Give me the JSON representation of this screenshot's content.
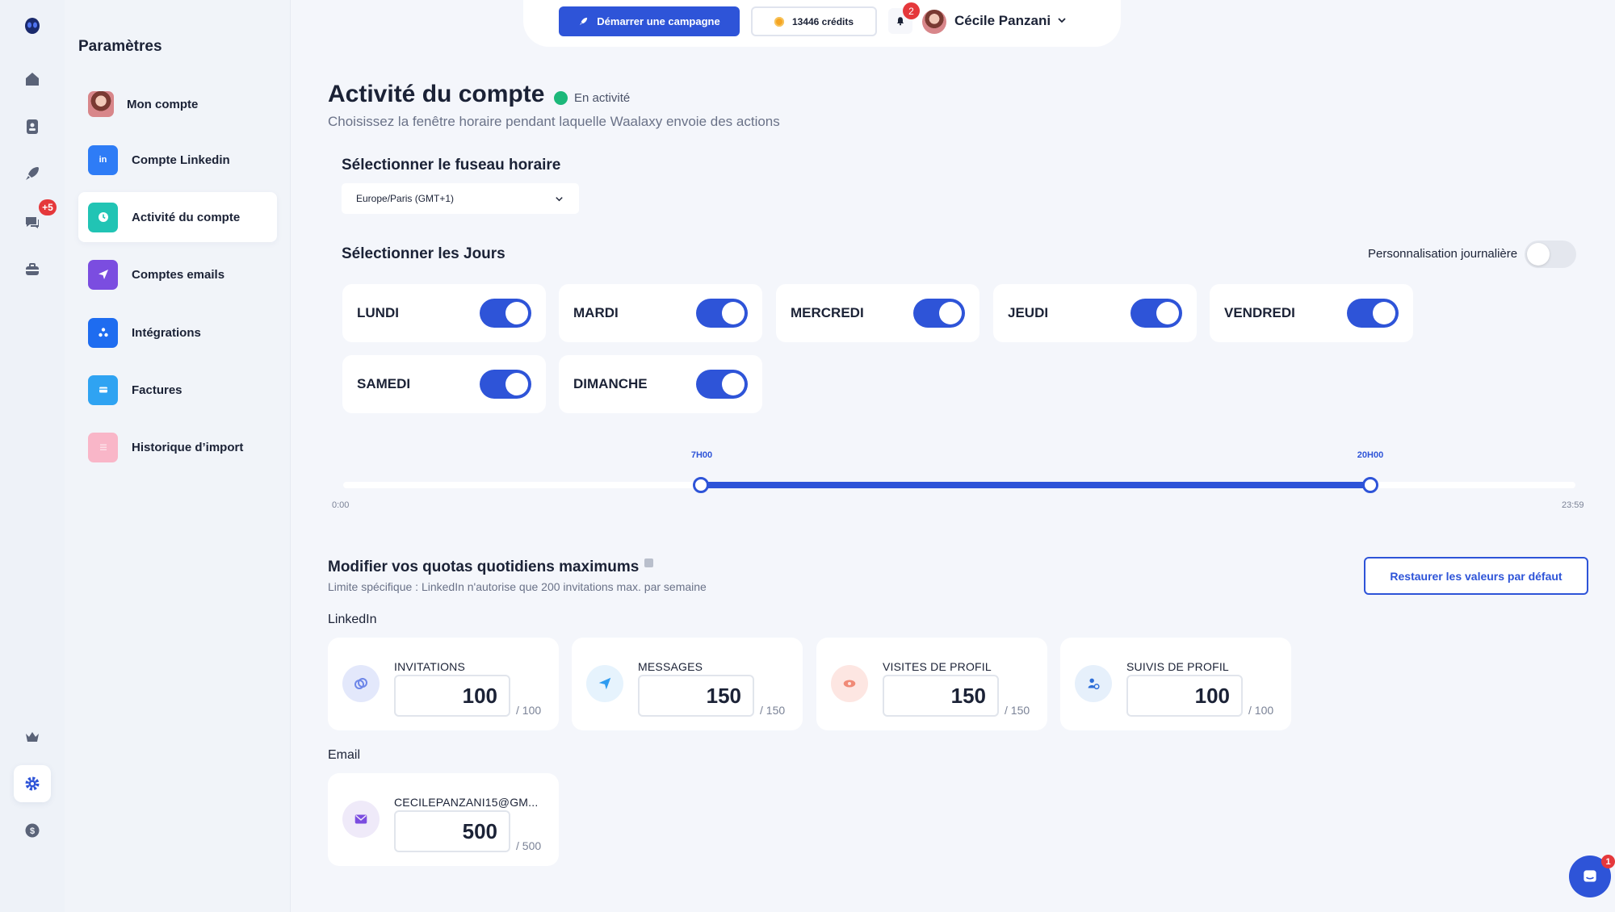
{
  "topbar": {
    "campaign_label": "Démarrer une campagne",
    "credits_label": "13446 crédits",
    "notif_count": "2",
    "user_name": "Cécile Panzani"
  },
  "rail": {
    "messages_badge": "+5"
  },
  "sidebar": {
    "title": "Paramètres",
    "items": [
      {
        "label": "Mon compte",
        "icon": "avatar"
      },
      {
        "label": "Compte Linkedin",
        "icon": "linkedin-icon",
        "glyph": "in",
        "color": "#2e7cf6"
      },
      {
        "label": "Activité du compte",
        "icon": "clock-icon",
        "color": "#21c4b4"
      },
      {
        "label": "Comptes emails",
        "icon": "paper-plane-icon",
        "color": "#7b4de0"
      },
      {
        "label": "Intégrations",
        "icon": "integrations-icon",
        "color": "#1e6cf0"
      },
      {
        "label": "Factures",
        "icon": "invoice-icon",
        "color": "#2fa3f2"
      },
      {
        "label": "Historique d’import",
        "icon": "list-icon",
        "color": "#f9b6c8"
      }
    ]
  },
  "page": {
    "title": "Activité du compte",
    "status": "En activité",
    "subtitle": "Choisissez la fenêtre horaire pendant laquelle Waalaxy envoie des actions"
  },
  "timezone": {
    "heading": "Sélectionner le fuseau horaire",
    "value": "Europe/Paris (GMT+1)"
  },
  "days": {
    "heading": "Sélectionner les Jours",
    "personalize_label": "Personnalisation journalière",
    "personalize_on": false,
    "items": [
      {
        "label": "LUNDI",
        "on": true
      },
      {
        "label": "MARDI",
        "on": true
      },
      {
        "label": "MERCREDI",
        "on": true
      },
      {
        "label": "JEUDI",
        "on": true
      },
      {
        "label": "VENDREDI",
        "on": true
      },
      {
        "label": "SAMEDI",
        "on": true
      },
      {
        "label": "DIMANCHE",
        "on": true
      }
    ]
  },
  "time_range": {
    "start_label": "7H00",
    "end_label": "20H00",
    "min_label": "0:00",
    "max_label": "23:59"
  },
  "quotas": {
    "title": "Modifier vos quotas quotidiens maximums",
    "subtitle": "Limite spécifique : LinkedIn n'autorise que 200 invitations max. par semaine",
    "reset_label": "Restaurer les valeurs par défaut",
    "linkedin_heading": "LinkedIn",
    "email_heading": "Email",
    "linkedin": [
      {
        "title": "INVITATIONS",
        "value": "100",
        "max": "/ 100",
        "icon": "link-icon"
      },
      {
        "title": "MESSAGES",
        "value": "150",
        "max": "/ 150",
        "icon": "paper-plane-icon"
      },
      {
        "title": "VISITES DE PROFIL",
        "value": "150",
        "max": "/ 150",
        "icon": "eye-icon"
      },
      {
        "title": "SUIVIS DE PROFIL",
        "value": "100",
        "max": "/ 100",
        "icon": "user-follow-icon"
      }
    ],
    "email": [
      {
        "title": "CECILEPANZANI15@GM...",
        "value": "500",
        "max": "/ 500",
        "icon": "envelope-icon"
      }
    ]
  },
  "chat_badge": "1",
  "colors": {
    "accent": "#2e54d8",
    "status_green": "#1cb87a",
    "badge_red": "#e5383b",
    "background": "#f4f6fb"
  }
}
